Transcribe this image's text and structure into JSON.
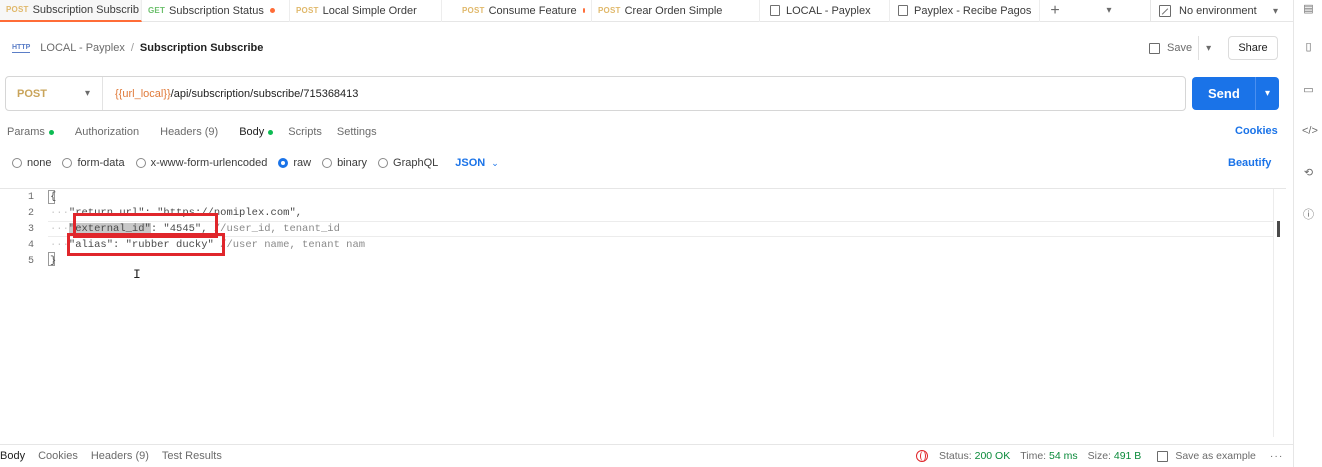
{
  "tabs": [
    {
      "method": "POST",
      "label": "Subscription Subscrib",
      "active": true,
      "unsaved": true
    },
    {
      "method": "GET",
      "label": "Subscription Status",
      "active": false,
      "unsaved": true
    },
    {
      "method": "POST",
      "label": "Local Simple Order",
      "active": false,
      "unsaved": false
    },
    {
      "method": "POST",
      "label": "Consume Feature",
      "active": false,
      "unsaved": true
    },
    {
      "method": "POST",
      "label": "Crear Orden Simple",
      "active": false,
      "unsaved": false
    },
    {
      "method": "",
      "label": "LOCAL - Payplex",
      "active": false,
      "unsaved": false
    },
    {
      "method": "",
      "label": "Payplex - Recibe Pagos",
      "active": false,
      "unsaved": false
    }
  ],
  "tab_controls": {
    "plus": "+",
    "chevron": "⌄"
  },
  "environment": {
    "label": "No environment"
  },
  "breadcrumb": {
    "icon_text": "HTTP",
    "parent": "LOCAL - Payplex",
    "separator": "/",
    "current": "Subscription Subscribe"
  },
  "toolbar": {
    "save_label": "Save",
    "share_label": "Share"
  },
  "request": {
    "method": "POST",
    "url_variable": "{{url_local}}",
    "url_path": "/api/subscription/subscribe/715368413",
    "send_label": "Send"
  },
  "request_tabs": [
    {
      "label": "Params",
      "dot": true,
      "active": false
    },
    {
      "label": "Authorization",
      "dot": false,
      "active": false
    },
    {
      "label": "Headers (9)",
      "dot": false,
      "active": false
    },
    {
      "label": "Body",
      "dot": true,
      "active": true
    },
    {
      "label": "Scripts",
      "dot": false,
      "active": false
    },
    {
      "label": "Settings",
      "dot": false,
      "active": false
    }
  ],
  "cookies_label": "Cookies",
  "body_types": [
    {
      "label": "none",
      "selected": false
    },
    {
      "label": "form-data",
      "selected": false
    },
    {
      "label": "x-www-form-urlencoded",
      "selected": false
    },
    {
      "label": "raw",
      "selected": true
    },
    {
      "label": "binary",
      "selected": false
    },
    {
      "label": "GraphQL",
      "selected": false
    }
  ],
  "body_format": "JSON",
  "beautify_label": "Beautify",
  "editor": {
    "line_numbers": [
      "1",
      "2",
      "3",
      "4",
      "5"
    ],
    "line1": "{",
    "line2_key": "\"return_url\"",
    "line2_rest": ": \"https://nomiplex.com\",",
    "line3_key": "\"external_id\"",
    "line3_value": ": \"4545\",",
    "line3_comment": " //user_id, tenant_id",
    "line4_key": "\"alias\"",
    "line4_value": ": \"rubber ducky\"",
    "line4_comment": " //user name, tenant nam",
    "line5": "}"
  },
  "response_tabs": [
    {
      "label": "Body",
      "active": true
    },
    {
      "label": "Cookies",
      "active": false
    },
    {
      "label": "Headers (9)",
      "active": false
    },
    {
      "label": "Test Results",
      "active": false
    }
  ],
  "response_status": {
    "status_label": "Status:",
    "status_value": "200 OK",
    "time_label": "Time:",
    "time_value": "54 ms",
    "size_label": "Size:",
    "size_value": "491 B",
    "save_example_label": "Save as example",
    "more": "···"
  },
  "colors": {
    "accent": "#1a73e8",
    "active_tab": "#ff6c37",
    "highlight_box": "#e0262b",
    "status_ok": "#0a8a3a"
  }
}
